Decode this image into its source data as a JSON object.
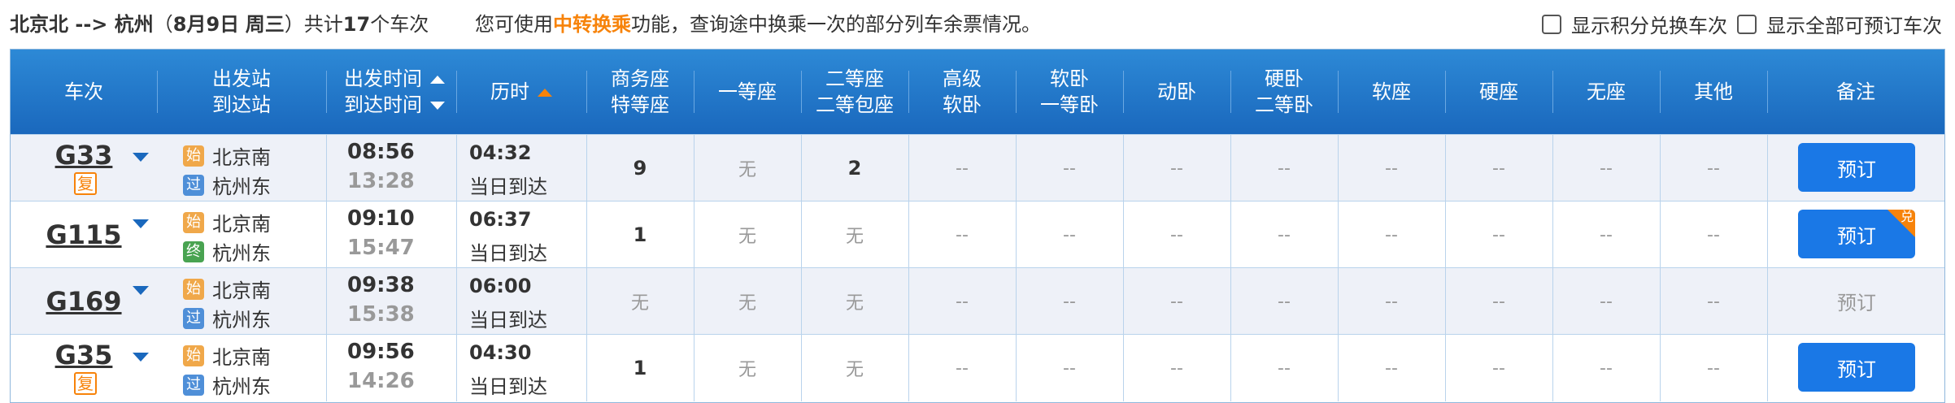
{
  "topbar": {
    "route": "北京北 --> 杭州",
    "date_prefix": "（",
    "date": "8月9日",
    "weekday": "周三",
    "date_suffix": "）",
    "total_prefix": "共计",
    "total_count": "17",
    "total_suffix": "个车次",
    "tip_prefix": "您可使用",
    "tip_highlight": "中转换乘",
    "tip_suffix": "功能，查询途中换乘一次的部分列车余票情况。",
    "option_points": "显示积分兑换车次",
    "option_all": "显示全部可预订车次"
  },
  "columns": {
    "train": "车次",
    "from": "出发站",
    "to": "到达站",
    "dep_time": "出发时间",
    "arr_time": "到达时间",
    "duration": "历时",
    "business1": "商务座",
    "business2": "特等座",
    "first": "一等座",
    "second1": "二等座",
    "second2": "二等包座",
    "soft_high1": "高级",
    "soft_high2": "软卧",
    "soft1": "软卧",
    "soft2": "一等卧",
    "moving": "动卧",
    "hard_sleeper1": "硬卧",
    "hard_sleeper2": "二等卧",
    "soft_seat": "软座",
    "hard_seat": "硬座",
    "no_seat": "无座",
    "other": "其他",
    "remark": "备注"
  },
  "rows": [
    {
      "train": "G33",
      "fu": "复",
      "from_tag": "始",
      "from": "北京南",
      "to_tag": "过",
      "to": "杭州东",
      "dep": "08:56",
      "arr": "13:28",
      "dur": "04:32",
      "arrive_note": "当日到达",
      "business": "9",
      "first": "无",
      "second": "2",
      "soft_high": "--",
      "soft": "--",
      "moving": "--",
      "hard_sleeper": "--",
      "soft_seat": "--",
      "hard_seat": "--",
      "no_seat": "--",
      "other": "--",
      "book": "预订"
    },
    {
      "train": "G115",
      "from_tag": "始",
      "from": "北京南",
      "to_tag": "终",
      "to": "杭州东",
      "dep": "09:10",
      "arr": "15:47",
      "dur": "06:37",
      "arrive_note": "当日到达",
      "business": "1",
      "first": "无",
      "second": "无",
      "soft_high": "--",
      "soft": "--",
      "moving": "--",
      "hard_sleeper": "--",
      "soft_seat": "--",
      "hard_seat": "--",
      "no_seat": "--",
      "other": "--",
      "book": "预订",
      "corner": "兑"
    },
    {
      "train": "G169",
      "from_tag": "始",
      "from": "北京南",
      "to_tag": "过",
      "to": "杭州东",
      "dep": "09:38",
      "arr": "15:38",
      "dur": "06:00",
      "arrive_note": "当日到达",
      "business": "无",
      "first": "无",
      "second": "无",
      "soft_high": "--",
      "soft": "--",
      "moving": "--",
      "hard_sleeper": "--",
      "soft_seat": "--",
      "hard_seat": "--",
      "no_seat": "--",
      "other": "--",
      "book": "预订"
    },
    {
      "train": "G35",
      "fu": "复",
      "from_tag": "始",
      "from": "北京南",
      "to_tag": "过",
      "to": "杭州东",
      "dep": "09:56",
      "arr": "14:26",
      "dur": "04:30",
      "arrive_note": "当日到达",
      "business": "1",
      "first": "无",
      "second": "无",
      "soft_high": "--",
      "soft": "--",
      "moving": "--",
      "hard_sleeper": "--",
      "soft_seat": "--",
      "hard_seat": "--",
      "no_seat": "--",
      "other": "--",
      "book": "预订"
    }
  ]
}
